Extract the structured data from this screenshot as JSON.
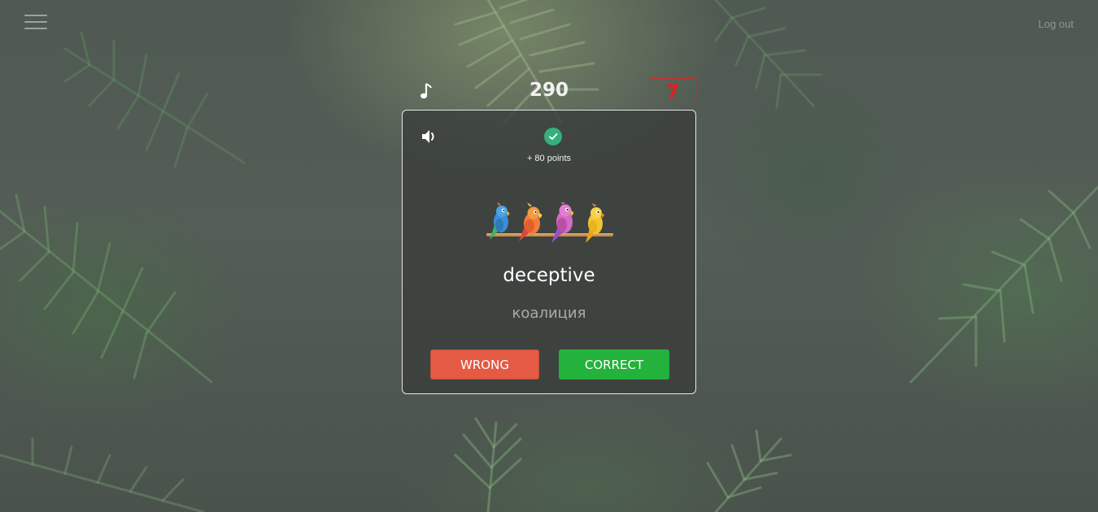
{
  "header": {
    "menu_icon": "hamburger-menu-icon",
    "logout_label": "Log out"
  },
  "game": {
    "music_icon": "music-note-icon",
    "score": "290",
    "timer": "7",
    "timer_color": "#e02020"
  },
  "card": {
    "sound_icon": "speaker-icon",
    "status_icon": "check-circle-icon",
    "status_color": "#35b07a",
    "points_awarded": "+ 80 points",
    "illustration": "parrots-on-branch-image",
    "word": "deceptive",
    "translation": "коалиция",
    "wrong_label": "WRONG",
    "correct_label": "CORRECT",
    "wrong_color": "#e55a43",
    "correct_color": "#23b23b"
  }
}
